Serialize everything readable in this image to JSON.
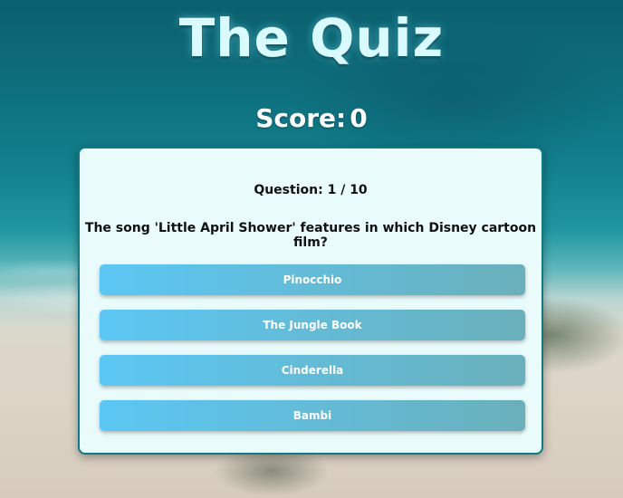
{
  "header": {
    "title": "The Quiz",
    "score_label": "Score:",
    "score_value": "0"
  },
  "quiz": {
    "question_label": "Question:",
    "current": "1",
    "separator": "/",
    "total": "10",
    "question_text": "The song 'Little April Shower' features in which Disney cartoon film?",
    "answers": [
      {
        "label": "Pinocchio"
      },
      {
        "label": "The Jungle Book"
      },
      {
        "label": "Cinderella"
      },
      {
        "label": "Bambi"
      }
    ]
  },
  "colors": {
    "card_background": "#e9fbfb",
    "card_border": "#0f7a86",
    "answer_gradient_start": "#5bc7f4",
    "answer_gradient_end": "#6ab0bb",
    "title_color": "#d9fbff"
  }
}
